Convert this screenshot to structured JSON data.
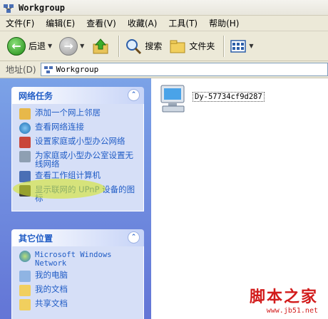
{
  "window": {
    "title": "Workgroup"
  },
  "menu": [
    "文件(F)",
    "编辑(E)",
    "查看(V)",
    "收藏(A)",
    "工具(T)",
    "帮助(H)"
  ],
  "toolbar": {
    "back": "后退",
    "search": "搜索",
    "folders": "文件夹"
  },
  "address": {
    "label": "地址(D)",
    "value": "Workgroup"
  },
  "network_tasks": {
    "title": "网络任务",
    "items": [
      "添加一个网上邻居",
      "查看网络连接",
      "设置家庭或小型办公网络",
      "为家庭或小型办公室设置无线网络",
      "查看工作组计算机",
      "显示联网的 UPnP 设备的图标"
    ]
  },
  "other_places": {
    "title": "其它位置",
    "items": [
      "Microsoft Windows Network",
      "我的电脑",
      "我的文档",
      "共享文档"
    ]
  },
  "main": {
    "computer_name": "Dy-57734cf9d287"
  },
  "watermark": {
    "text": "脚本之家",
    "url": "www.jb51.net"
  },
  "colors": {
    "panel_blue": "#6375d6",
    "link": "#215dc6",
    "highlight": "#d6e628",
    "watermark": "#d21b1b"
  }
}
